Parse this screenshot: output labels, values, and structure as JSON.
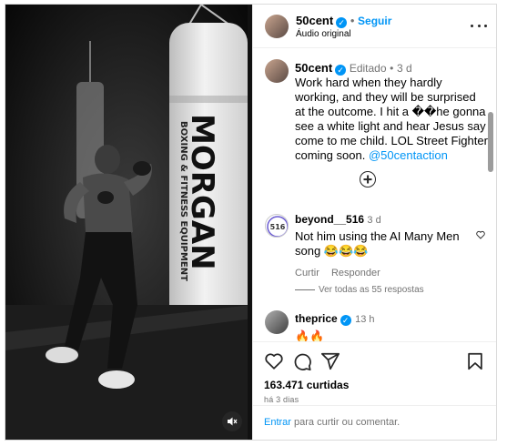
{
  "header": {
    "username": "50cent",
    "follow_label": "Seguir",
    "separator": "•",
    "audio_label": "Áudio original"
  },
  "caption": {
    "username": "50cent",
    "edited_label": "Editado",
    "time": "3 d",
    "text": "Work hard when they hardly working, and they will be surprised at the outcome. I hit a ��he gonna see a white light and hear Jesus say come to me child. LOL Street Fighter coming soon.",
    "mention": "@50centaction"
  },
  "comments": [
    {
      "username": "beyond__516",
      "time": "3 d",
      "text": "Not him using the AI Many Men song 😂😂😂",
      "reply_label": "Curtir",
      "respond_label": "Responder",
      "view_replies": "Ver todas as 55 respostas"
    },
    {
      "username": "theprice",
      "time": "13 h",
      "text": "🔥🔥"
    }
  ],
  "footer": {
    "likes": "163.471 curtidas",
    "posted_ago": "há 3 dias",
    "add_comment_link": "Entrar",
    "add_comment_text": " para curtir ou comentar."
  },
  "media": {
    "bag_text_main": "MORGAN",
    "bag_text_sub": "BOXING & FITNESS EQUIPMENT"
  },
  "colors": {
    "accent": "#0095f6",
    "muted": "#737373",
    "border": "#efefef"
  }
}
